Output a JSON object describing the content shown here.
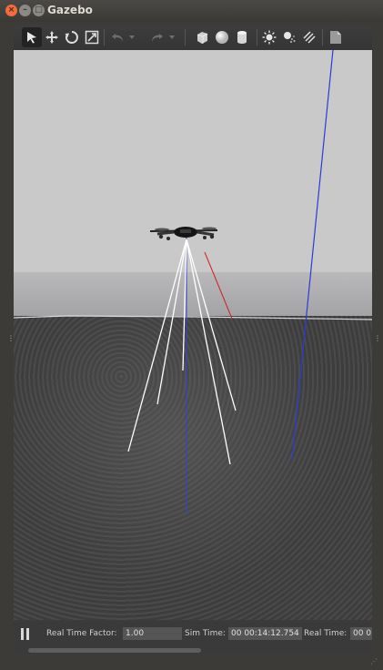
{
  "window": {
    "title": "Gazebo"
  },
  "titlebar_buttons": {
    "close": "×",
    "minimize": "–",
    "maximize": "□"
  },
  "toolbar": {
    "tools": [
      {
        "name": "select-arrow-icon",
        "active": true
      },
      {
        "name": "translate-icon"
      },
      {
        "name": "rotate-icon"
      },
      {
        "name": "scale-icon"
      },
      {
        "name": "undo-icon"
      },
      {
        "name": "undo-dropdown-icon"
      },
      {
        "name": "redo-icon"
      },
      {
        "name": "redo-dropdown-icon"
      },
      {
        "name": "box-shape-icon"
      },
      {
        "name": "sphere-shape-icon"
      },
      {
        "name": "cylinder-shape-icon"
      },
      {
        "name": "point-light-icon"
      },
      {
        "name": "spot-light-icon"
      },
      {
        "name": "directional-light-icon"
      },
      {
        "name": "screenshot-icon"
      }
    ]
  },
  "status": {
    "real_time_factor_label": "Real Time Factor:",
    "real_time_factor_value": "1.00",
    "sim_time_label": "Sim Time:",
    "sim_time_value": "00 00:14:12.754",
    "real_time_label": "Real Time:",
    "real_time_value": "00 0"
  },
  "colors": {
    "accent": "#f26d3d",
    "sky": "#c9c9ca",
    "ground": "#444444"
  }
}
